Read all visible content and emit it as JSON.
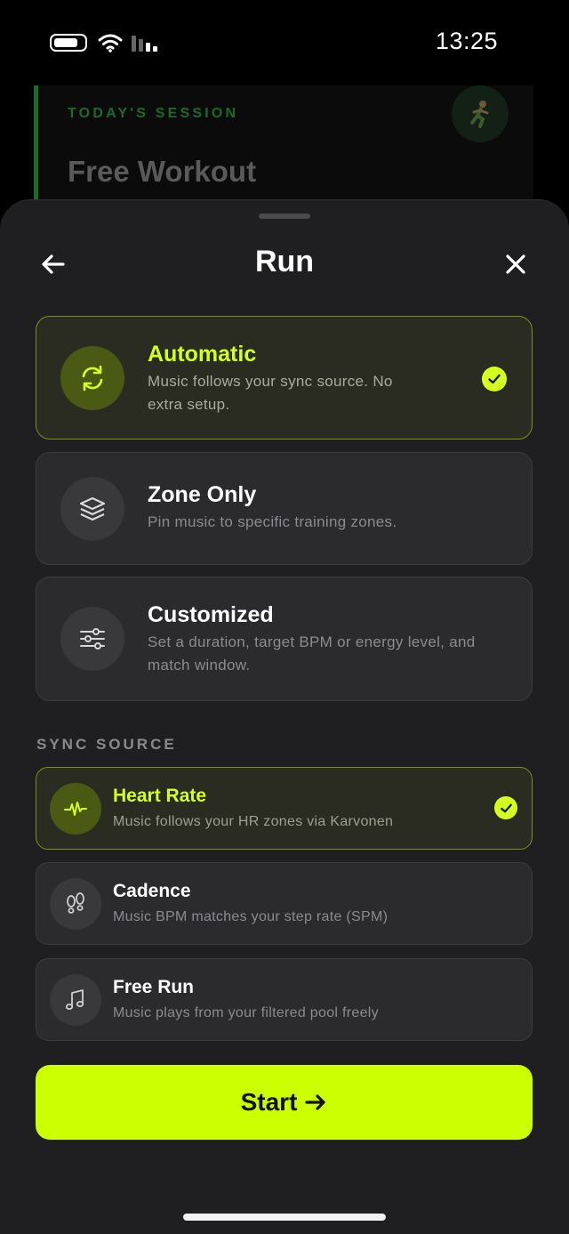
{
  "status_bar": {
    "time": "13:25"
  },
  "background": {
    "session_label": "TODAY'S SESSION",
    "session_title": "Free Workout"
  },
  "sheet": {
    "title": "Run",
    "modes": [
      {
        "title": "Automatic",
        "desc_line1": "Music follows your sync source. No",
        "desc_line2": "extra setup.",
        "selected": true,
        "icon": "sync-arrows-icon"
      },
      {
        "title": "Zone Only",
        "desc_line1": "Pin music to specific training zones.",
        "desc_line2": "",
        "selected": false,
        "icon": "layers-icon"
      },
      {
        "title": "Customized",
        "desc_line1": "Set a duration, target BPM or energy level, and",
        "desc_line2": "match window.",
        "selected": false,
        "icon": "sliders-icon"
      }
    ],
    "sync_section_label": "SYNC SOURCE",
    "sync_sources": [
      {
        "title": "Heart Rate",
        "desc": "Music follows your HR zones via Karvonen",
        "selected": true,
        "icon": "heartbeat-icon"
      },
      {
        "title": "Cadence",
        "desc": "Music BPM matches your step rate (SPM)",
        "selected": false,
        "icon": "footsteps-icon"
      },
      {
        "title": "Free Run",
        "desc": "Music plays from your filtered pool freely",
        "selected": false,
        "icon": "music-note-icon"
      }
    ],
    "start_label": "Start"
  },
  "colors": {
    "accent": "#ccff00",
    "selected_border": "#7c8f1c",
    "sheet_bg": "#1f1f22",
    "card_bg": "#2b2b2f"
  }
}
